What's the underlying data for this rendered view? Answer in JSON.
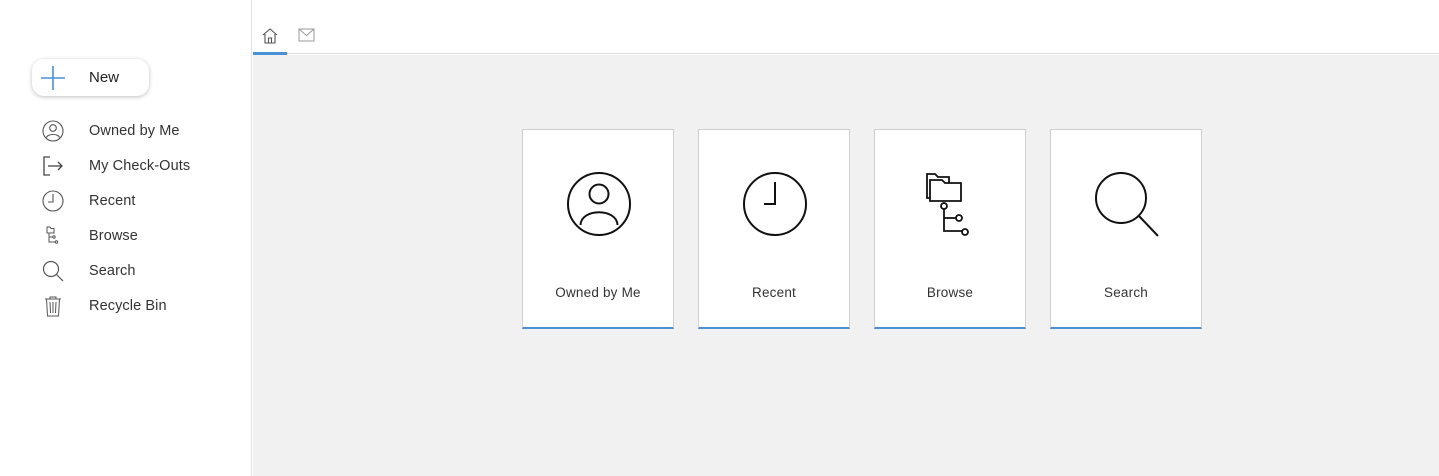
{
  "sidebar": {
    "new_label": "New",
    "items": [
      {
        "label": "Owned by Me",
        "icon": "user-circle-icon"
      },
      {
        "label": "My Check-Outs",
        "icon": "check-out-icon"
      },
      {
        "label": "Recent",
        "icon": "clock-icon"
      },
      {
        "label": "Browse",
        "icon": "folder-tree-icon"
      },
      {
        "label": "Search",
        "icon": "search-icon"
      },
      {
        "label": "Recycle Bin",
        "icon": "trash-icon"
      }
    ]
  },
  "tabs": [
    {
      "icon": "home-icon",
      "active": true
    },
    {
      "icon": "mail-icon",
      "active": false
    }
  ],
  "cards": [
    {
      "label": "Owned by Me",
      "icon": "user-circle-icon"
    },
    {
      "label": "Recent",
      "icon": "clock-icon"
    },
    {
      "label": "Browse",
      "icon": "folder-tree-icon"
    },
    {
      "label": "Search",
      "icon": "search-icon"
    }
  ],
  "colors": {
    "accent": "#4a90d9",
    "background": "#f1f1f1",
    "plus": "#4a90d9"
  }
}
